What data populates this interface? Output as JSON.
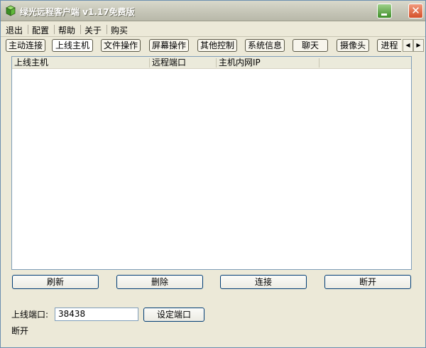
{
  "window": {
    "title": "绿光远程客户端 v1.17免费版"
  },
  "menu": [
    "退出",
    "配置",
    "帮助",
    "关于",
    "购买"
  ],
  "tabs": [
    "主动连接",
    "上线主机",
    "文件操作",
    "屏幕操作",
    "其他控制",
    "系统信息",
    "聊天",
    "摄像头",
    "进程"
  ],
  "tab_scroll": {
    "left": "◀",
    "right": "▶"
  },
  "list": {
    "columns": [
      "上线主机",
      "远程端口",
      "主机内网IP"
    ],
    "rows": []
  },
  "actions": [
    "刷新",
    "删除",
    "连接",
    "断开"
  ],
  "port": {
    "label": "上线端口:",
    "value": "38438",
    "button": "设定端口"
  },
  "status": "断开",
  "icons": {
    "app": "app-cube-icon",
    "minimize": "minimize-icon",
    "close": "close-icon"
  },
  "colors": {
    "window_bg": "#ece9d8",
    "close_button": "#d4502a",
    "minimize_button": "#3f8f2a",
    "list_border": "#7f9db9"
  }
}
